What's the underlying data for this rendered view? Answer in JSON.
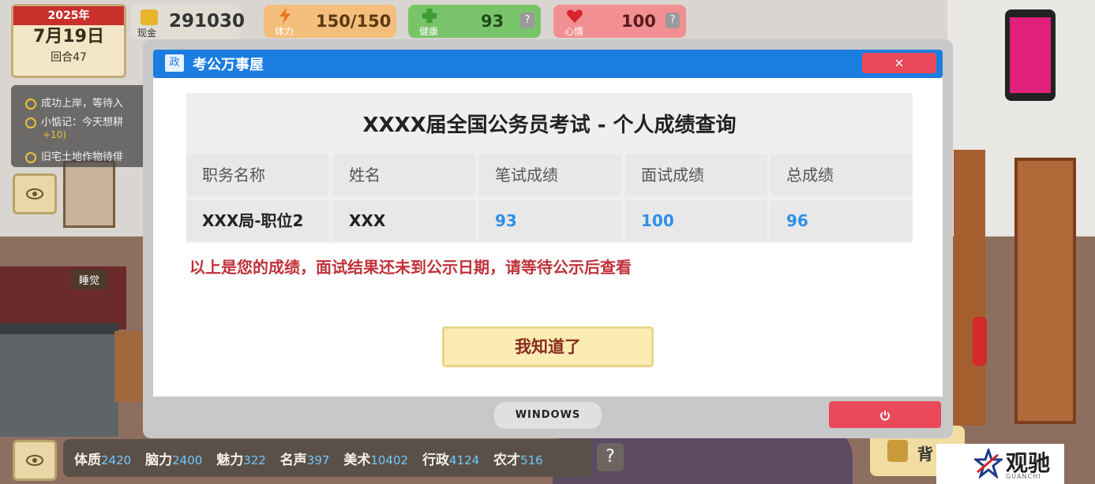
{
  "hud": {
    "calendar": {
      "year": "2025年",
      "date": "7月19日",
      "round": "回合47"
    },
    "cash": {
      "label": "现金",
      "value": "291030"
    },
    "stamina": {
      "label": "体力",
      "value": "150/150"
    },
    "health": {
      "label": "健康",
      "value": "93",
      "help": "?"
    },
    "mood": {
      "label": "心情",
      "value": "100",
      "help": "?"
    }
  },
  "tasks": [
    "成功上岸，等待入",
    "小惦记：今天想耕",
    "+10)",
    "旧宅土地作物待俳"
  ],
  "room": {
    "sleep_tag": "睡觉"
  },
  "window": {
    "title_icon": "政",
    "title": "考公万事屋",
    "close": "×",
    "exam_title": "XXXX届全国公务员考试 - 个人成绩查询",
    "table": {
      "headers": [
        "职务名称",
        "姓名",
        "笔试成绩",
        "面试成绩",
        "总成绩"
      ],
      "row": [
        "XXX局-职位2",
        "XXX",
        "93",
        "100",
        "96"
      ]
    },
    "notice": "以上是您的成绩，面试结果还未到公示日期，请等待公示后查看",
    "ok_button": "我知道了",
    "taskbar_label": "WINDOWS"
  },
  "attributes": [
    {
      "name": "体质",
      "value": "2420"
    },
    {
      "name": "脑力",
      "value": "2400"
    },
    {
      "name": "魅力",
      "value": "322"
    },
    {
      "name": "名声",
      "value": "397"
    },
    {
      "name": "美术",
      "value": "10402"
    },
    {
      "name": "行政",
      "value": "4124"
    },
    {
      "name": "农才",
      "value": "516"
    }
  ],
  "bottom": {
    "help": "?",
    "bag_label": "背"
  },
  "watermark": {
    "name": "观驰",
    "sub": "GUANCHI"
  },
  "colors": {
    "title_blue": "#1b7de0",
    "close_red": "#e9495a",
    "score_blue": "#2f8fe8",
    "notice_red": "#c0323a"
  }
}
